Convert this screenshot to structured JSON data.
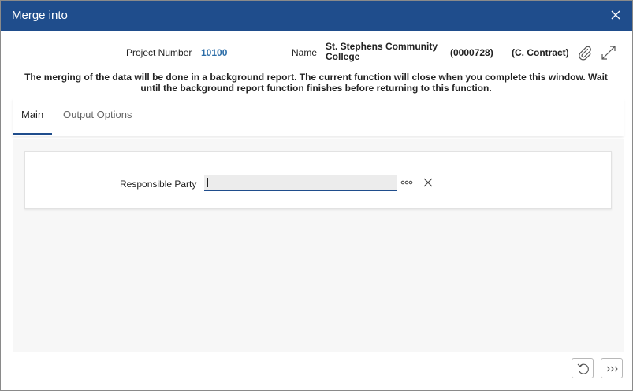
{
  "window": {
    "title": "Merge into"
  },
  "header": {
    "project_number_label": "Project Number",
    "project_number_value": "10100",
    "name_label": "Name",
    "name_value": "St. Stephens Community College",
    "code_value": "(0000728)",
    "type_value": "(C. Contract)"
  },
  "notice": "The merging of the data will be done in a background report. The current function will close when you complete this window. Wait until the background report function finishes before returning to this function.",
  "tabs": [
    {
      "label": "Main",
      "active": true
    },
    {
      "label": "Output Options",
      "active": false
    }
  ],
  "form": {
    "responsible_party_label": "Responsible Party",
    "responsible_party_value": ""
  },
  "icons": {
    "close": "close-icon",
    "attach": "paperclip-icon",
    "expand": "expand-icon",
    "lookup": "more-dots-icon",
    "clear": "clear-icon",
    "undo": "undo-icon",
    "next": "next-icon"
  },
  "colors": {
    "titlebar": "#1f4d8c",
    "link": "#2d6ea8",
    "accent": "#1f4d8c"
  }
}
